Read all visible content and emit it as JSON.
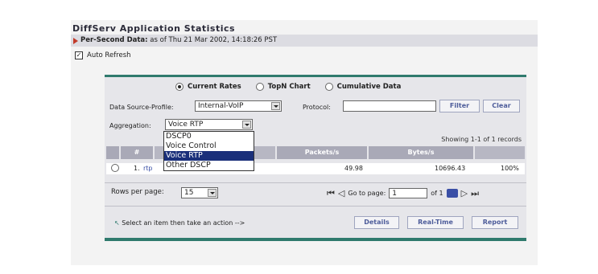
{
  "page": {
    "title": "DiffServ Application Statistics",
    "subbar_bold": "Per-Second Data:",
    "subbar_text": " as of Thu 21 Mar 2002, 14:18:26 PST",
    "auto_refresh_label": "Auto Refresh",
    "auto_refresh_checked": true
  },
  "view_tabs": [
    {
      "label": "Current Rates",
      "selected": true
    },
    {
      "label": "TopN Chart",
      "selected": false
    },
    {
      "label": "Cumulative Data",
      "selected": false
    }
  ],
  "filters": {
    "data_source_label": "Data Source-Profile:",
    "data_source_value": "Internal-VoIP",
    "protocol_label": "Protocol:",
    "protocol_value": "",
    "filter_button": "Filter",
    "clear_button": "Clear",
    "aggregation_label": "Aggregation:",
    "aggregation_value": "Voice RTP",
    "aggregation_options": [
      "DSCP0",
      "Voice Control",
      "Voice RTP",
      "Other DSCP"
    ],
    "aggregation_selected_index": 2
  },
  "table": {
    "showing": "Showing 1-1 of 1 records",
    "headers": {
      "num": "#",
      "packets": "Packets/s",
      "bytes": "Bytes/s"
    },
    "rows": [
      {
        "index": "1.",
        "name": "rtp",
        "packets": "49.98",
        "bytes": "10696.43",
        "percent": "100%"
      }
    ]
  },
  "pagination": {
    "rows_per_page_label": "Rows per page:",
    "rows_per_page_value": "15",
    "goto_label": "Go to page:",
    "goto_value": "1",
    "of_label": "of 1"
  },
  "actions": {
    "hint": "Select an item then take an action -->",
    "details": "Details",
    "realtime": "Real-Time",
    "report": "Report"
  },
  "colors": {
    "accent": "#2f7a6d",
    "header_bg": "#a9a9b7",
    "selection": "#1a2f7a",
    "button_text": "#4d5c9a"
  }
}
